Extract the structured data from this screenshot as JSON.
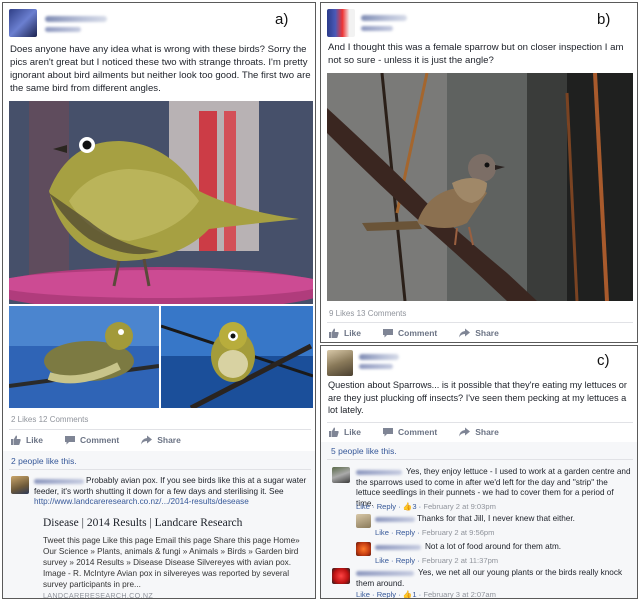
{
  "panel_a": {
    "letter": "a)",
    "post_text": "Does anyone have any idea what is wrong with these birds? Sorry the pics aren't great but I noticed these two with strange throats. I'm pretty ignorant about bird ailments but neither look too good. The first two are the same bird from different angles.",
    "stats": "2 Likes  12 Comments",
    "actions": {
      "like": "Like",
      "comment": "Comment",
      "share": "Share"
    },
    "people_like": "2 people like this.",
    "comment_text": "Probably avian pox. If you see birds like this at a sugar water feeder, it's worth shutting it down for a few days and sterilising it. See",
    "comment_link": "http://www.landcareresearch.co.nz/.../2014-results/desease",
    "card": {
      "title": "Disease | 2014 Results | Landcare Research",
      "description": "Tweet this page Like this page Email this page Share this page Home» Our Science » Plants, animals & fungi » Animals » Birds » Garden bird survey » 2014 Results » Disease Disease Silvereyes with avian pox. Image - R. McIntyre Avian pox in silvereyes was reported by several survey participants in pre...",
      "domain": "LANDCARERESEARCH.CO.NZ"
    }
  },
  "panel_b": {
    "letter": "b)",
    "post_text": "And I thought this was a female sparrow but on closer inspection I am not so sure - unless it is just the angle?",
    "stats": "9 Likes  13 Comments",
    "actions": {
      "like": "Like",
      "comment": "Comment",
      "share": "Share"
    }
  },
  "panel_c": {
    "letter": "c)",
    "post_text": "Question about Sparrows... is it possible that they're eating my lettuces or are they just plucking off insects? I've seen them pecking at my lettuces a lot lately.",
    "actions": {
      "like": "Like",
      "comment": "Comment",
      "share": "Share"
    },
    "people_like": "5 people like this.",
    "comments": [
      {
        "text": "Yes, they enjoy lettuce - I used to work at a garden centre and the sparrows used to come in after we'd left for the day and \"strip\" the lettuce seedlings in their punnets - we had to cover them for a period of time.",
        "like": "Like",
        "reply": "Reply",
        "likes": "3",
        "time": "February 2 at 9:03pm"
      },
      {
        "text": "Thanks for that Jill, I never knew that either.",
        "like": "Like",
        "reply": "Reply",
        "time": "February 2 at 9:56pm"
      },
      {
        "text": "Not a lot of food around for them atm.",
        "like": "Like",
        "reply": "Reply",
        "time": "February 2 at 11:37pm"
      },
      {
        "text": "Yes, we net all our young plants or the birds really knock them around.",
        "like": "Like",
        "reply": "Reply",
        "likes": "1",
        "time": "February 3 at 2:07am"
      }
    ]
  }
}
